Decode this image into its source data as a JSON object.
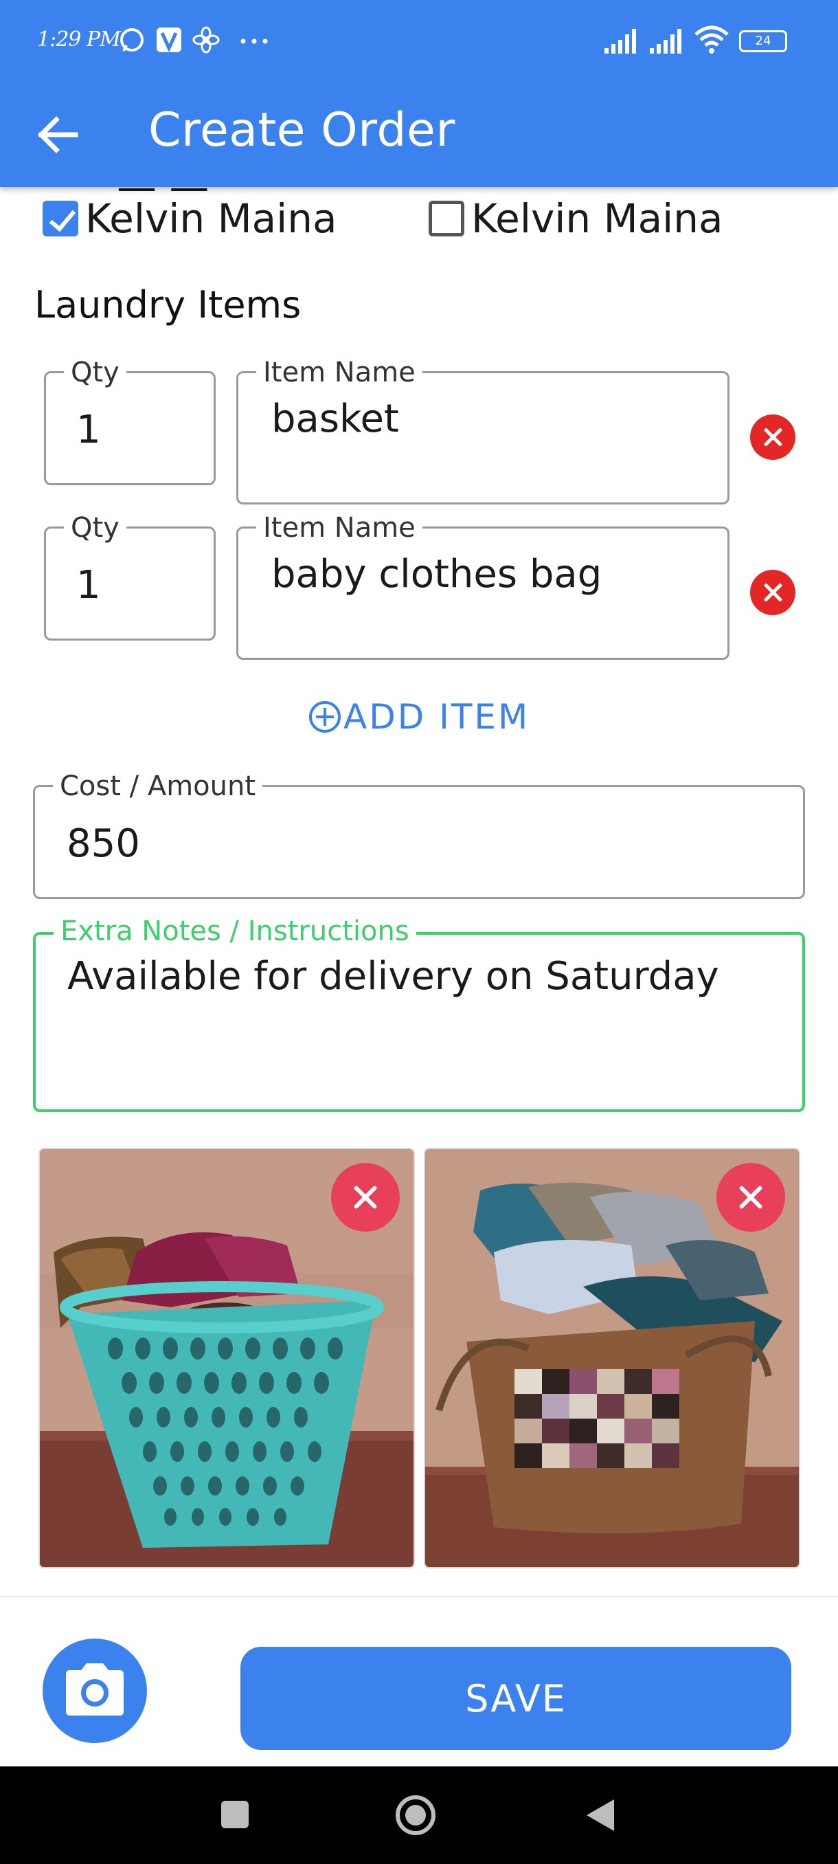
{
  "status_bar": {
    "time": "1:29 PM",
    "battery": "24",
    "icons": [
      "whatsapp-icon",
      "v-app-icon",
      "pinwheel-icon",
      "more-dots-icon",
      "signal-icon",
      "signal-icon",
      "wifi-icon",
      "battery-icon"
    ]
  },
  "app_bar": {
    "title": "Create Order",
    "back_icon": "arrow-left-icon",
    "color": "#3b82ee"
  },
  "customers": [
    {
      "name": "Kelvin Maina",
      "checked": true
    },
    {
      "name": "Kelvin Maina",
      "checked": false
    }
  ],
  "laundry": {
    "section_title": "Laundry Items",
    "qty_label": "Qty",
    "item_label": "Item Name",
    "items": [
      {
        "qty": "1",
        "name": "basket"
      },
      {
        "qty": "1",
        "name": "baby clothes bag"
      }
    ],
    "add_label": "ADD ITEM"
  },
  "cost": {
    "label": "Cost / Amount",
    "value": "850"
  },
  "notes": {
    "label": "Extra Notes / Instructions",
    "value": "Available for delivery on Saturday",
    "focus_color": "#3ecf6d"
  },
  "photos": [
    {
      "subject": "laundry-basket-photo"
    },
    {
      "subject": "clothes-bag-photo"
    }
  ],
  "actions": {
    "save_label": "SAVE",
    "camera_icon": "camera-icon"
  },
  "nav": [
    "recents-icon",
    "home-icon",
    "back-icon"
  ]
}
